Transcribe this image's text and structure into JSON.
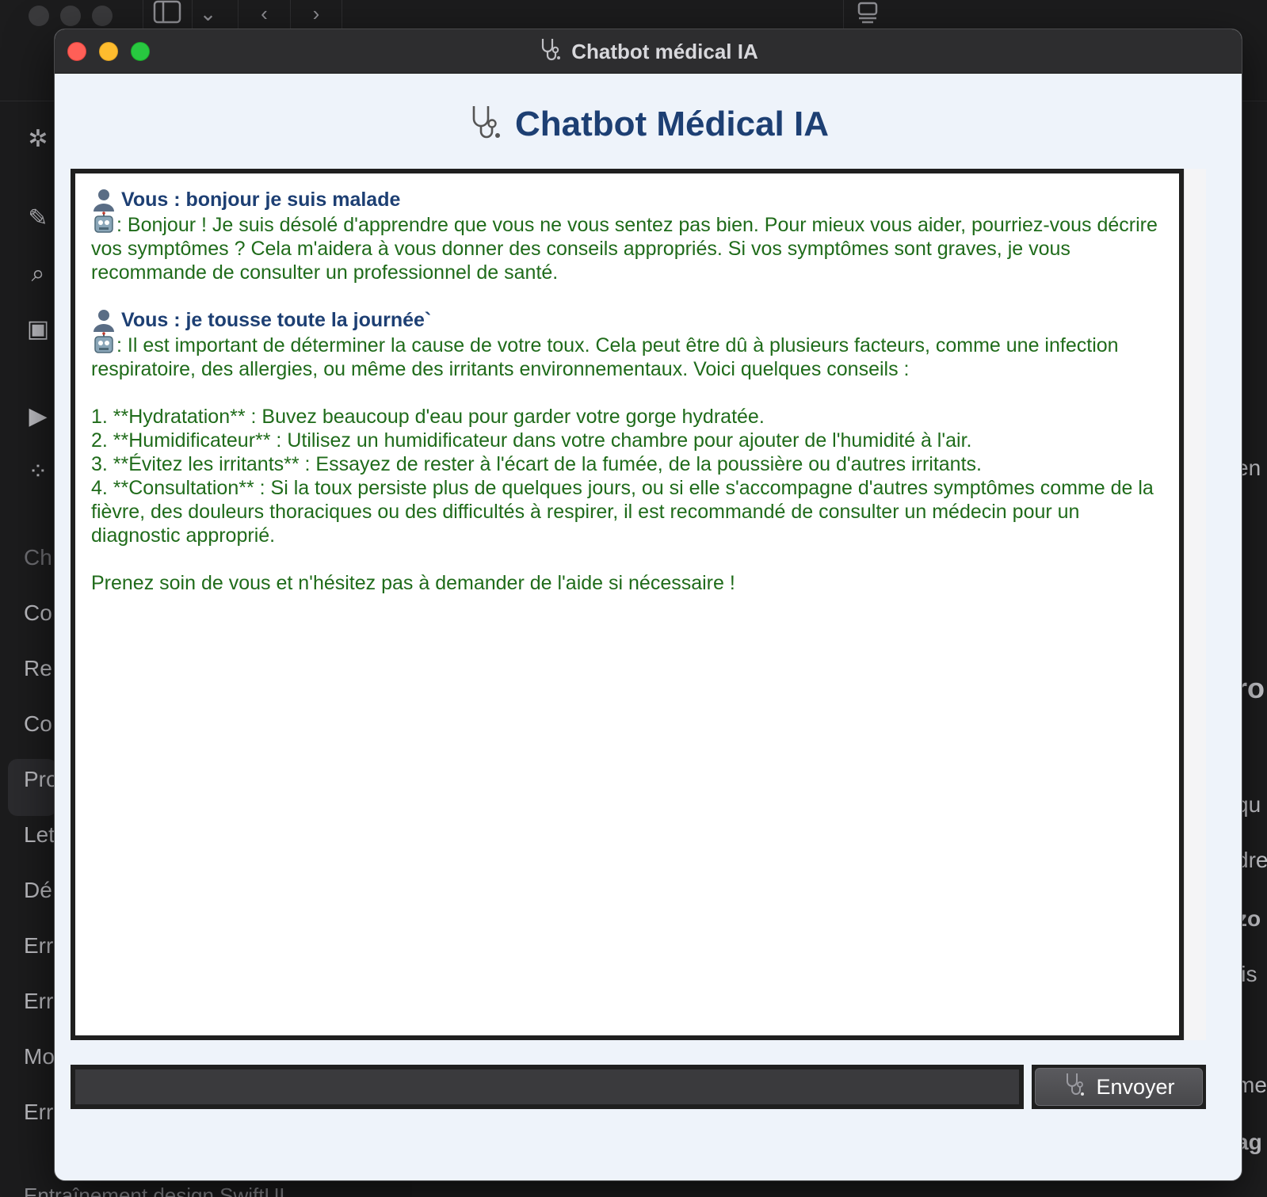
{
  "window": {
    "title": "Chatbot médical IA"
  },
  "app": {
    "heading": "Chatbot Médical IA"
  },
  "messages": [
    {
      "user": "Vous : bonjour je suis malade",
      "bot": ": Bonjour ! Je suis désolé d'apprendre que vous ne vous sentez pas bien. Pour mieux vous aider, pourriez-vous décrire vos symptômes ? Cela m'aidera à vous donner des conseils appropriés. Si vos symptômes sont graves, je vous recommande de consulter un professionnel de santé."
    },
    {
      "user": "Vous : je tousse toute la journée`",
      "bot": ": Il est important de déterminer la cause de votre toux. Cela peut être dû à plusieurs facteurs, comme une infection respiratoire, des allergies, ou même des irritants environnementaux. Voici quelques conseils :",
      "list": [
        "1. **Hydratation** : Buvez beaucoup d'eau pour garder votre gorge hydratée.",
        "2. **Humidificateur** : Utilisez un humidificateur dans votre chambre pour ajouter de l'humidité à l'air.",
        "3. **Évitez les irritants** : Essayez de rester à l'écart de la fumée, de la poussière ou d'autres irritants.",
        "4. **Consultation** : Si la toux persiste plus de quelques jours, ou si elle s'accompagne d'autres symptômes comme de la fièvre, des douleurs thoraciques ou des difficultés à respirer, il est recommandé de consulter un médecin pour un diagnostic approprié."
      ],
      "closing": "Prenez soin de vous et n'hésitez pas à demander de l'aide si nécessaire !"
    }
  ],
  "input": {
    "value": "",
    "placeholder": ""
  },
  "send_button": {
    "label": "Envoyer"
  },
  "icons": {
    "title_icon": "stethoscope-icon",
    "user_icon": "user-silhouette-icon",
    "bot_icon": "robot-icon"
  },
  "colors": {
    "user_text": "#1d3f73",
    "bot_text": "#1f6b1a",
    "heading": "#1d3f73",
    "window_bg": "#eef3fa"
  },
  "background_app": {
    "sidebar_items": [
      "Ch",
      "Co",
      "Re",
      "Co",
      "Pro",
      "Let",
      "Dé",
      "Err",
      "Err",
      "Mo",
      "Err"
    ],
    "bottom_text": "Entraînement design SwiftUI",
    "right_fragments": [
      "en",
      "ro",
      ":",
      "qu",
      "dre",
      "zo",
      "lis",
      ":",
      "me",
      "ag"
    ]
  }
}
